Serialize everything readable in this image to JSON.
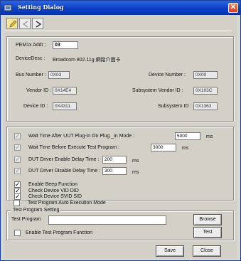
{
  "title": "Setting Dialog",
  "device": {
    "pem_label": "PEM1x Addr :",
    "pem_value": "03",
    "desc_label": "DeviceDesc :",
    "desc_value": "Broadcom 802.11g 網路介面卡",
    "bus_label": "Bus Number :",
    "bus_value": "0X03",
    "devnum_label": "Device Number :",
    "devnum_value": "0X00",
    "vendor_label": "Vendor ID :",
    "vendor_value": "0X14E4",
    "subvendor_label": "Subsystem Vendor ID :",
    "subvendor_value": "0X103C",
    "deviceid_label": "Device ID :",
    "deviceid_value": "0X4311",
    "subsys_label": "Subsystem ID :",
    "subsys_value": "0X1363"
  },
  "timing": {
    "wait_plugin_label": "Wait Time  After UUT Plug-in On  Plug _in Mode :",
    "wait_plugin_value": "5000",
    "wait_plugin_unit": "ms",
    "wait_exec_label": "Wait Time  Before Execute Test Program  :",
    "wait_exec_value": "3000",
    "wait_exec_unit": "ms",
    "enable_delay_label": "DUT Driver Enable Delay Time :",
    "enable_delay_value": "200",
    "enable_delay_unit": "ms",
    "disable_delay_label": "DUT Driver Disable Delay Time :",
    "disable_delay_value": "300",
    "disable_delay_unit": "ms"
  },
  "options": {
    "beep_label": "Enable Beep  Function",
    "vid_label": "Check Device   VID DID",
    "svid_label": "Check Device   SVID SID",
    "auto_label": "Test Program  Auto Execution Mode"
  },
  "test_program": {
    "group_title": "Test Program Setting",
    "label": "Test Program",
    "value": "",
    "browse_label": "Browse",
    "enable_label": "Enable Test Program Function",
    "test_label": "Test"
  },
  "footer": {
    "save_label": "Save",
    "close_label": "Close"
  },
  "colors": {
    "titlebar": "#0a3fc4",
    "dialog_bg": "#d4d0c8"
  }
}
